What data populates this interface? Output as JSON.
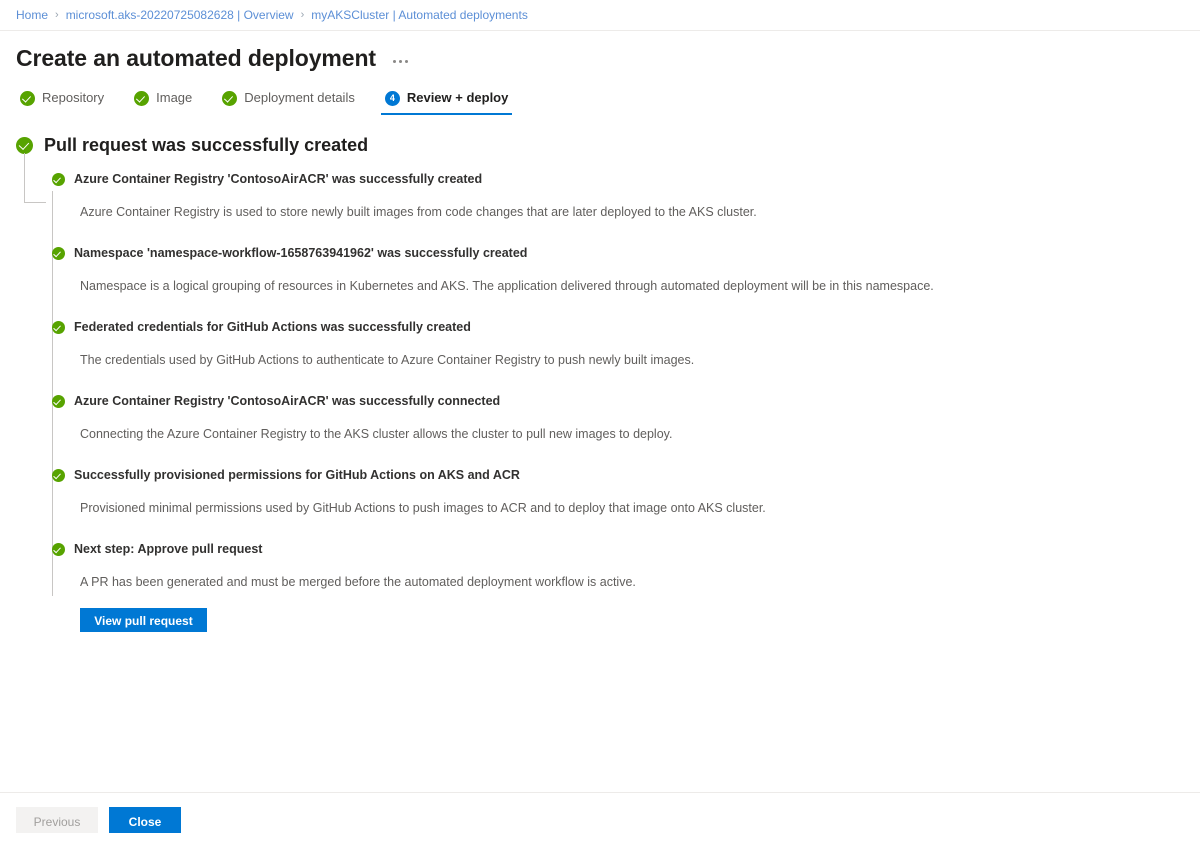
{
  "breadcrumb": {
    "separator": "›",
    "items": [
      {
        "label": "Home"
      },
      {
        "label": "microsoft.aks-20220725082628 | Overview"
      },
      {
        "label": "myAKSCluster | Automated deployments"
      }
    ]
  },
  "header": {
    "title": "Create an automated deployment",
    "more_menu": "more-options"
  },
  "wizard": {
    "tabs": [
      {
        "label": "Repository",
        "state": "completed",
        "badge": "check"
      },
      {
        "label": "Image",
        "state": "completed",
        "badge": "check"
      },
      {
        "label": "Deployment details",
        "state": "completed",
        "badge": "check"
      },
      {
        "label": "Review + deploy",
        "state": "active",
        "badge": "4"
      }
    ]
  },
  "result": {
    "heading": "Pull request was successfully created",
    "items": [
      {
        "title": "Azure Container Registry 'ContosoAirACR' was successfully created",
        "description": "Azure Container Registry is used to store newly built images from code changes that are later deployed to the AKS cluster.",
        "status": "success"
      },
      {
        "title": "Namespace 'namespace-workflow-1658763941962' was successfully created",
        "description": "Namespace is a logical grouping of resources in Kubernetes and AKS. The application delivered through automated deployment will be in this namespace.",
        "status": "success"
      },
      {
        "title": "Federated credentials for GitHub Actions was successfully created",
        "description": "The credentials used by GitHub Actions to authenticate to Azure Container Registry to push newly built images.",
        "status": "success"
      },
      {
        "title": "Azure Container Registry 'ContosoAirACR' was successfully connected",
        "description": "Connecting the Azure Container Registry to the AKS cluster allows the cluster to pull new images to deploy.",
        "status": "success"
      },
      {
        "title": "Successfully provisioned permissions for GitHub Actions on AKS and ACR",
        "description": "Provisioned minimal permissions used by GitHub Actions to push images to ACR and to deploy that image onto AKS cluster.",
        "status": "success"
      },
      {
        "title": "Next step: Approve pull request",
        "description": "A PR has been generated and must be merged before the automated deployment workflow is active.",
        "status": "success",
        "action_label": "View pull request"
      }
    ]
  },
  "footer": {
    "previous_label": "Previous",
    "close_label": "Close"
  },
  "colors": {
    "accent": "#0078d4",
    "success": "#57a300",
    "link": "#5c8fd6",
    "text": "#323130",
    "muted": "#605e5c",
    "divider": "#edebe9",
    "tree_line": "#c8c6c4",
    "disabled_bg": "#f3f2f1",
    "disabled_text": "#a19f9d"
  }
}
